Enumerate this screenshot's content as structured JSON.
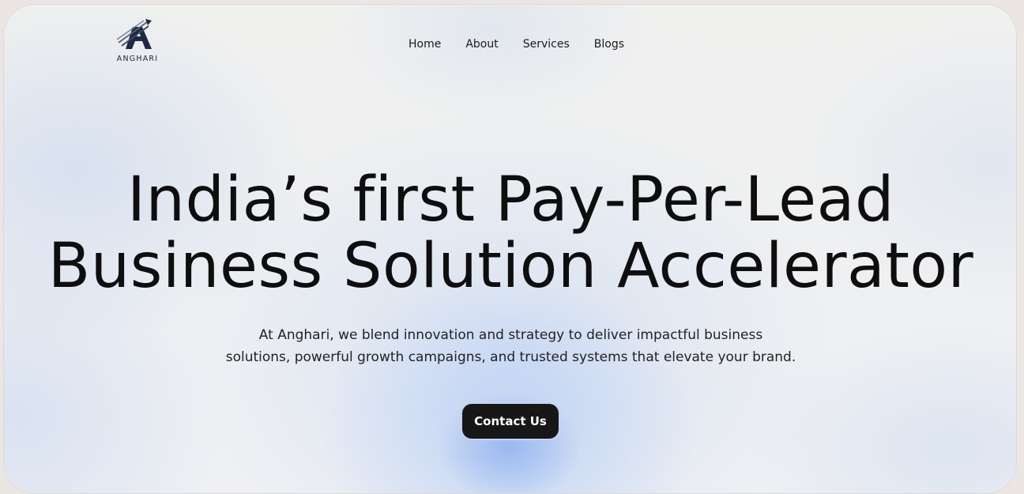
{
  "brand": {
    "name": "ANGHARI",
    "logo_icon": "arrow-up-right-A-logo",
    "accent": "#1e2a44"
  },
  "nav": {
    "items": [
      {
        "label": "Home"
      },
      {
        "label": "About"
      },
      {
        "label": "Services"
      },
      {
        "label": "Blogs"
      }
    ]
  },
  "hero": {
    "headline_line1": "India’s first Pay-Per-Lead",
    "headline_line2": "Business Solution Accelerator",
    "subtitle_line1": "At Anghari, we blend innovation and strategy to deliver impactful business",
    "subtitle_line2": "solutions, powerful growth campaigns, and trusted systems that elevate your brand.",
    "cta_label": "Contact Us"
  },
  "colors": {
    "cta_bg": "#171717",
    "background": "#f0f0ef",
    "glow": "#8cafef"
  }
}
